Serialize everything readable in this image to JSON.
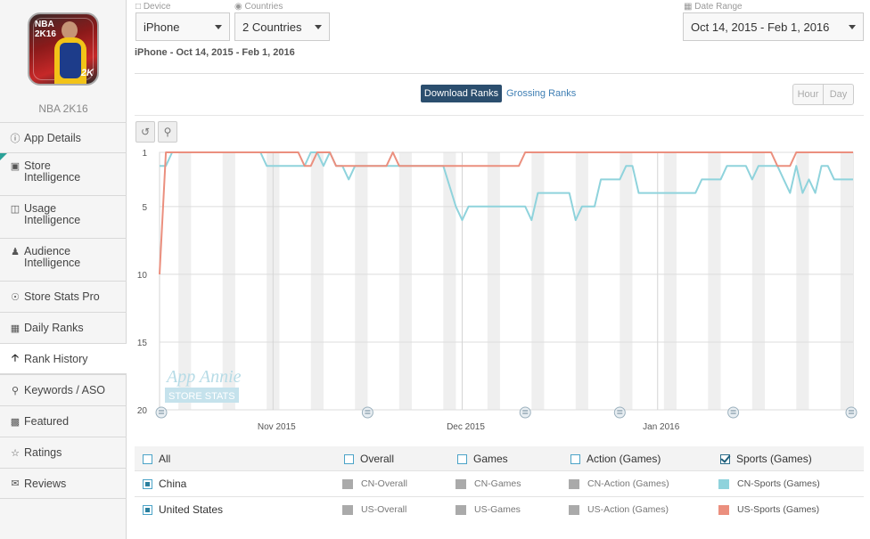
{
  "app": {
    "name": "NBA 2K16",
    "icon_text_line1": "NBA",
    "icon_text_line2": "2K16",
    "icon_text_brand": "2K"
  },
  "sidebar": {
    "items": [
      {
        "label": "App Details",
        "icon": "info-icon"
      },
      {
        "label": "Store Intelligence",
        "icon": "store-icon"
      },
      {
        "label": "Usage Intelligence",
        "icon": "usage-icon"
      },
      {
        "label": "Audience Intelligence",
        "icon": "person-icon"
      },
      {
        "label": "Store Stats Pro",
        "icon": "gauge-icon"
      },
      {
        "label": "Daily Ranks",
        "icon": "calendar-icon"
      },
      {
        "label": "Rank History",
        "icon": "arrow-up-icon",
        "active": true
      },
      {
        "label": "Keywords / ASO",
        "icon": "key-icon"
      },
      {
        "label": "Featured",
        "icon": "featured-icon"
      },
      {
        "label": "Ratings",
        "icon": "star-icon"
      },
      {
        "label": "Reviews",
        "icon": "comments-icon"
      }
    ]
  },
  "filters": {
    "device_label": "Device",
    "device_value": "iPhone",
    "countries_label": "Countries",
    "countries_value": "2 Countries",
    "date_label": "Date Range",
    "date_value": "Oct 14, 2015 - Feb 1, 2016"
  },
  "summary": "iPhone - Oct 14, 2015 - Feb 1, 2016",
  "rank_tabs": {
    "download": "Download Ranks",
    "grossing": "Grossing Ranks"
  },
  "granularity": {
    "hour": "Hour",
    "day": "Day"
  },
  "chart_data": {
    "type": "line",
    "y_reversed": true,
    "ylim": [
      20,
      1
    ],
    "y_ticks": [
      "1",
      "5",
      "10",
      "15",
      "20"
    ],
    "x_ticks": [
      "Nov 2015",
      "Dec 2015",
      "Jan 2016"
    ],
    "watermark_line1": "App Annie",
    "watermark_line2": "STORE STATS",
    "x_start": "2015-10-14",
    "x_end": "2016-02-01",
    "series": [
      {
        "name": "CN-Sports (Games)",
        "color": "#8fd3dc",
        "points": [
          [
            "2015-10-14",
            2
          ],
          [
            "2015-10-15",
            2
          ],
          [
            "2015-10-16",
            1
          ],
          [
            "2015-10-30",
            1
          ],
          [
            "2015-10-31",
            2
          ],
          [
            "2015-11-06",
            2
          ],
          [
            "2015-11-07",
            1
          ],
          [
            "2015-11-08",
            1
          ],
          [
            "2015-11-09",
            2
          ],
          [
            "2015-11-10",
            1
          ],
          [
            "2015-11-11",
            2
          ],
          [
            "2015-11-12",
            2
          ],
          [
            "2015-11-13",
            3
          ],
          [
            "2015-11-14",
            2
          ],
          [
            "2015-11-28",
            2
          ],
          [
            "2015-11-30",
            5
          ],
          [
            "2015-12-01",
            6
          ],
          [
            "2015-12-02",
            5
          ],
          [
            "2015-12-11",
            5
          ],
          [
            "2015-12-12",
            6
          ],
          [
            "2015-12-13",
            4
          ],
          [
            "2015-12-18",
            4
          ],
          [
            "2015-12-19",
            6
          ],
          [
            "2015-12-20",
            5
          ],
          [
            "2015-12-22",
            5
          ],
          [
            "2015-12-23",
            3
          ],
          [
            "2015-12-26",
            3
          ],
          [
            "2015-12-27",
            2
          ],
          [
            "2015-12-28",
            2
          ],
          [
            "2015-12-29",
            4
          ],
          [
            "2016-01-07",
            4
          ],
          [
            "2016-01-08",
            3
          ],
          [
            "2016-01-11",
            3
          ],
          [
            "2016-01-12",
            2
          ],
          [
            "2016-01-15",
            2
          ],
          [
            "2016-01-16",
            3
          ],
          [
            "2016-01-17",
            2
          ],
          [
            "2016-01-20",
            2
          ],
          [
            "2016-01-21",
            3
          ],
          [
            "2016-01-22",
            4
          ],
          [
            "2016-01-23",
            2
          ],
          [
            "2016-01-24",
            4
          ],
          [
            "2016-01-25",
            3
          ],
          [
            "2016-01-26",
            4
          ],
          [
            "2016-01-27",
            2
          ],
          [
            "2016-01-28",
            2
          ],
          [
            "2016-01-29",
            3
          ],
          [
            "2016-02-01",
            3
          ]
        ]
      },
      {
        "name": "US-Sports (Games)",
        "color": "#eb8f7e",
        "points": [
          [
            "2015-10-14",
            10
          ],
          [
            "2015-10-15",
            1
          ],
          [
            "2015-11-05",
            1
          ],
          [
            "2015-11-06",
            2
          ],
          [
            "2015-11-07",
            2
          ],
          [
            "2015-11-08",
            1
          ],
          [
            "2015-11-10",
            1
          ],
          [
            "2015-11-11",
            2
          ],
          [
            "2015-11-19",
            2
          ],
          [
            "2015-11-20",
            1
          ],
          [
            "2015-11-21",
            2
          ],
          [
            "2015-12-10",
            2
          ],
          [
            "2015-12-11",
            1
          ],
          [
            "2016-01-19",
            1
          ],
          [
            "2016-01-20",
            2
          ],
          [
            "2016-01-22",
            2
          ],
          [
            "2016-01-23",
            1
          ],
          [
            "2016-02-01",
            1
          ]
        ]
      }
    ]
  },
  "legend": {
    "header": [
      "All",
      "Overall",
      "Games",
      "Action (Games)",
      "Sports (Games)"
    ],
    "rows": [
      {
        "country": "China",
        "cells": [
          "CN-Overall",
          "CN-Games",
          "CN-Action (Games)",
          "CN-Sports (Games)"
        ]
      },
      {
        "country": "United States",
        "cells": [
          "US-Overall",
          "US-Games",
          "US-Action (Games)",
          "US-Sports (Games)"
        ]
      }
    ],
    "gray": "#aaaaaa",
    "cn_color": "#8fd3dc",
    "us_color": "#eb8f7e"
  }
}
